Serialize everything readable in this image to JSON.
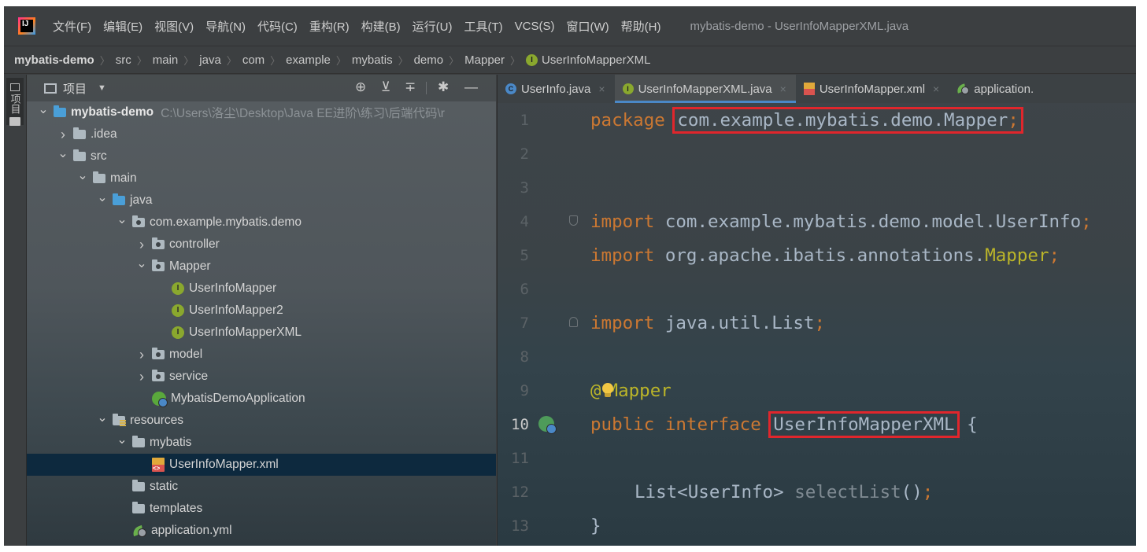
{
  "app": {
    "logo_text": "IJ",
    "menu": [
      "文件(F)",
      "编辑(E)",
      "视图(V)",
      "导航(N)",
      "代码(C)",
      "重构(R)",
      "构建(B)",
      "运行(U)",
      "工具(T)",
      "VCS(S)",
      "窗口(W)",
      "帮助(H)"
    ],
    "window_title": "mybatis-demo - UserInfoMapperXML.java"
  },
  "breadcrumb": [
    "mybatis-demo",
    "src",
    "main",
    "java",
    "com",
    "example",
    "mybatis",
    "demo",
    "Mapper",
    "UserInfoMapperXML"
  ],
  "stripe": {
    "label": "项目"
  },
  "project": {
    "title": "项目",
    "tree": [
      {
        "label": "mybatis-demo",
        "path": "C:\\Users\\洛尘\\Desktop\\Java EE进阶\\练习\\后端代码\\r",
        "depth": 0,
        "chev": "open",
        "icon": "module",
        "bold": true
      },
      {
        "label": ".idea",
        "depth": 1,
        "chev": "closed",
        "icon": "folder"
      },
      {
        "label": "src",
        "depth": 1,
        "chev": "open",
        "icon": "folder"
      },
      {
        "label": "main",
        "depth": 2,
        "chev": "open",
        "icon": "folder"
      },
      {
        "label": "java",
        "depth": 3,
        "chev": "open",
        "icon": "folder-blue"
      },
      {
        "label": "com.example.mybatis.demo",
        "depth": 4,
        "chev": "open",
        "icon": "package"
      },
      {
        "label": "controller",
        "depth": 5,
        "chev": "closed",
        "icon": "package"
      },
      {
        "label": "Mapper",
        "depth": 5,
        "chev": "open",
        "icon": "package"
      },
      {
        "label": "UserInfoMapper",
        "depth": 6,
        "chev": "none",
        "icon": "interface"
      },
      {
        "label": "UserInfoMapper2",
        "depth": 6,
        "chev": "none",
        "icon": "interface"
      },
      {
        "label": "UserInfoMapperXML",
        "depth": 6,
        "chev": "none",
        "icon": "interface"
      },
      {
        "label": "model",
        "depth": 5,
        "chev": "closed",
        "icon": "package"
      },
      {
        "label": "service",
        "depth": 5,
        "chev": "closed",
        "icon": "package"
      },
      {
        "label": "MybatisDemoApplication",
        "depth": 5,
        "chev": "none",
        "icon": "spring"
      },
      {
        "label": "resources",
        "depth": 3,
        "chev": "open",
        "icon": "resources"
      },
      {
        "label": "mybatis",
        "depth": 4,
        "chev": "open",
        "icon": "folder"
      },
      {
        "label": "UserInfoMapper.xml",
        "depth": 5,
        "chev": "none",
        "icon": "xml",
        "selected": true
      },
      {
        "label": "static",
        "depth": 4,
        "chev": "none",
        "icon": "folder"
      },
      {
        "label": "templates",
        "depth": 4,
        "chev": "none",
        "icon": "folder"
      },
      {
        "label": "application.yml",
        "depth": 4,
        "chev": "none",
        "icon": "yml"
      }
    ]
  },
  "tabs": [
    {
      "label": "UserInfo.java",
      "icon": "class"
    },
    {
      "label": "UserInfoMapperXML.java",
      "icon": "interface",
      "active": true
    },
    {
      "label": "UserInfoMapper.xml",
      "icon": "xml"
    },
    {
      "label": "application.",
      "icon": "yml",
      "partial": true
    }
  ],
  "tab_close": "×",
  "code": {
    "pkg_kw": "package",
    "pkg_name": "com.example.mybatis.demo.Mapper",
    "import_kw": "import",
    "import1": "com.example.mybatis.demo.model.UserInfo",
    "import2_pre": "org.apache.ibatis.annotations.",
    "import2_cls": "Mapper",
    "import3": "java.util.List",
    "semi": ";",
    "ann_at": "@",
    "ann_name": "Mapper",
    "public_kw": "public",
    "interface_kw": "interface",
    "iface_name": "UserInfoMapperXML",
    "open_brace": "{",
    "method_type": "List<UserInfo>",
    "method_name": "selectList",
    "method_paren": "()",
    "close_brace": "}",
    "line_numbers": [
      "1",
      "2",
      "3",
      "4",
      "5",
      "6",
      "7",
      "8",
      "9",
      "10",
      "11",
      "12",
      "13"
    ],
    "current_line": "10"
  }
}
